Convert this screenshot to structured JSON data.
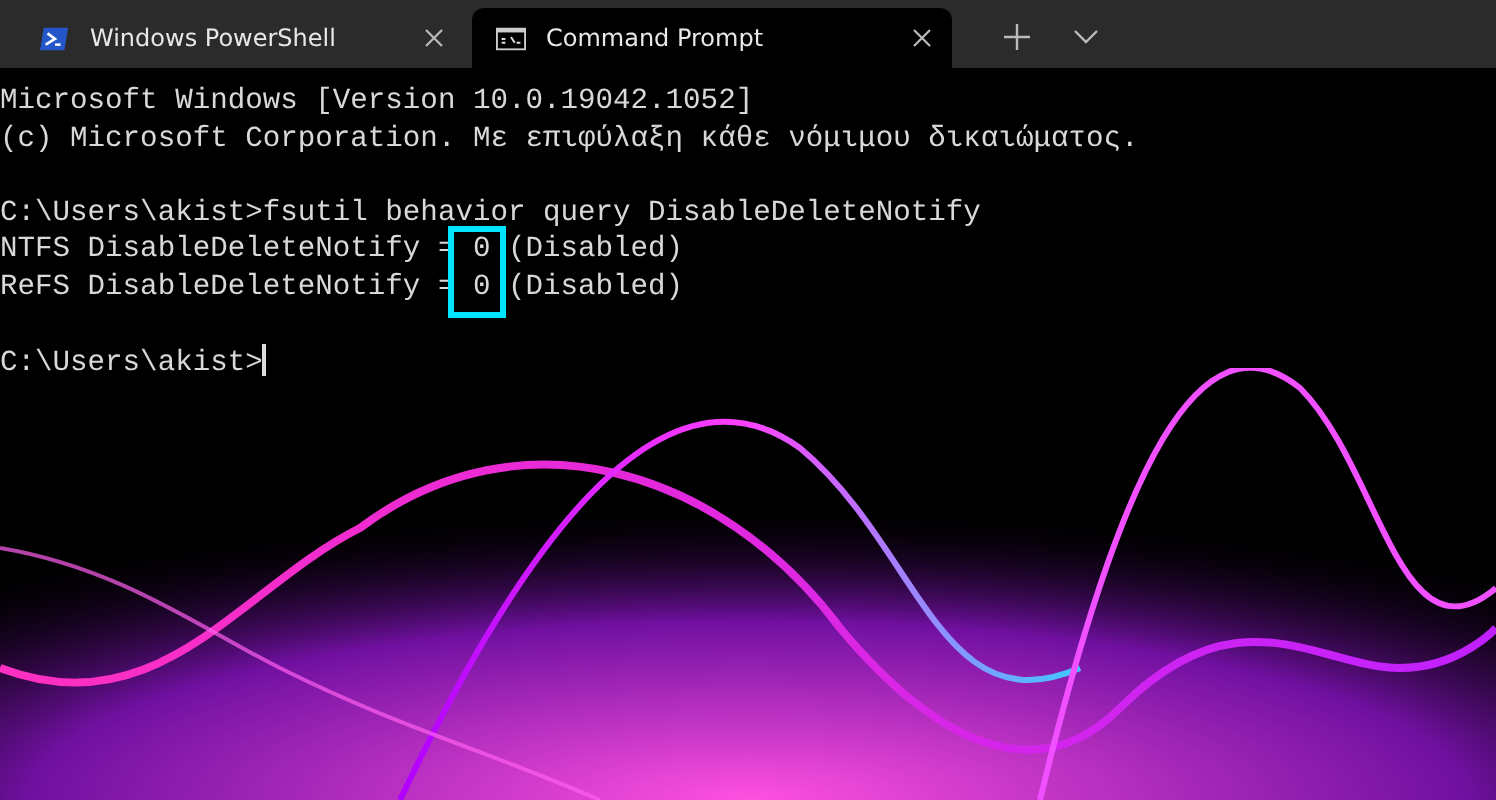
{
  "tabs": [
    {
      "label": "Windows PowerShell",
      "kind": "powershell",
      "selected": false
    },
    {
      "label": "Command Prompt",
      "kind": "cmd",
      "selected": true
    }
  ],
  "terminal": {
    "lines": [
      {
        "kind": "output",
        "text": "Microsoft Windows [Version 10.0.19042.1052]"
      },
      {
        "kind": "output",
        "text": "(c) Microsoft Corporation. Με επιφύλαξη κάθε νόμιμου δικαιώματος."
      },
      {
        "kind": "blank"
      },
      {
        "kind": "output",
        "text": "C:\\Users\\akist>fsutil behavior query DisableDeleteNotify"
      },
      {
        "kind": "output",
        "text": "NTFS DisableDeleteNotify = 0 (Disabled)"
      },
      {
        "kind": "output",
        "text": "ReFS DisableDeleteNotify = 0 (Disabled)"
      },
      {
        "kind": "blank"
      },
      {
        "kind": "prompt",
        "text": "C:\\Users\\akist>",
        "cursor": true
      }
    ],
    "annotation": {
      "kind": "highlight-box"
    }
  }
}
